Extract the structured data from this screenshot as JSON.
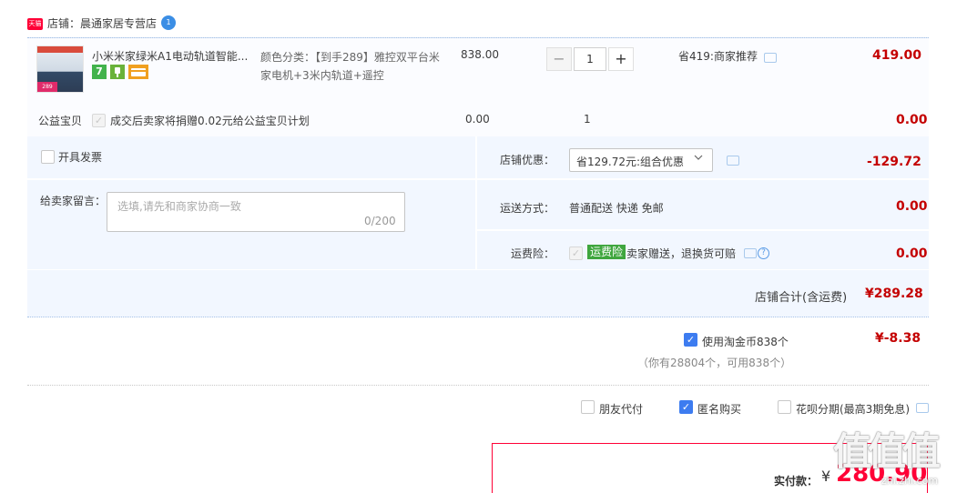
{
  "shop": {
    "badge": "天猫",
    "name": "店铺：晨通家居专营店",
    "chat_badge": "1"
  },
  "item": {
    "title": "小米米家绿米A1电动轨道智能...",
    "tag7": "7",
    "sku_label": "颜色分类：【到手289】雅控双平台米家电机+3米内轨道+遥控",
    "unit_price": "838.00",
    "qty": "1",
    "qty_minus": "−",
    "qty_plus": "+",
    "discount_note": "省419:商家推荐",
    "total": "419.00",
    "thumb_badge": "289"
  },
  "welfare": {
    "label": "公益宝贝",
    "text": "成交后卖家将捐赠0.02元给公益宝贝计划",
    "price": "0.00",
    "qty": "1",
    "total": "0.00"
  },
  "options": {
    "invoice_label": "开具发票",
    "message_label": "给卖家留言：",
    "message_placeholder": "选填,请先和商家协商一致",
    "message_count": "0/200",
    "shop_discount_label": "店铺优惠：",
    "shop_discount_selected": "省129.72元:组合优惠",
    "shop_discount_amount": "-129.72",
    "shipping_label": "运送方式：",
    "shipping_value": "普通配送 快递 免邮",
    "shipping_amount": "0.00",
    "insurance_label": "运费险：",
    "insurance_tag": "运费险",
    "insurance_text": "卖家赠送，退换货可赔",
    "insurance_amount": "0.00"
  },
  "shop_total": {
    "label": "店铺合计(含运费)",
    "amount": "¥289.28"
  },
  "coins": {
    "label": "使用淘金币838个",
    "amount": "¥-8.38",
    "sub": "（你有28804个，可用838个）"
  },
  "pay_options": {
    "friend_pay": "朋友代付",
    "anonymous": "匿名购买",
    "huabei": "花呗分期(最高3期免息)"
  },
  "payment": {
    "label": "实付款：",
    "symbol": "¥",
    "amount": "280.90"
  },
  "watermark": {
    "text": "值值值",
    "sub": "zhi.zhi.com"
  },
  "colors": {
    "accent_red": "#c40000",
    "tmall_red": "#ff0036",
    "row_bg": "#f2f7ff",
    "checkbox_blue": "#3d7cf0",
    "insurance_green": "#3fa63e"
  }
}
